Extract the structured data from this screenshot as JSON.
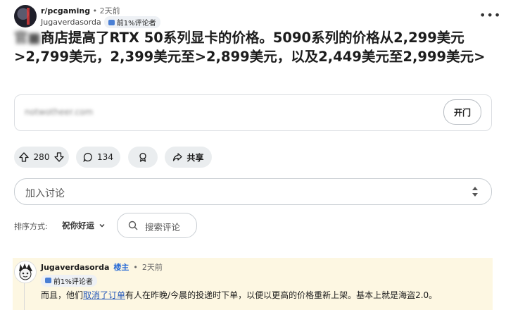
{
  "post": {
    "subreddit": "r/pcgaming",
    "separator": "•",
    "time": "2天前",
    "author": "Jugaverdasorda",
    "author_flair": "前1%评论者",
    "title_blurred": "官■",
    "title": "商店提高了RTX 50系列显卡的价格。5090系列的价格从2,299美元>2,799美元，2,399美元至>2,899美元，以及2,449美元至2,999美元>",
    "link_url": "notwotheer.com",
    "open_label": "开门"
  },
  "actions": {
    "upvotes": "280",
    "comments": "134",
    "share_label": "共享"
  },
  "add_comment": {
    "placeholder": "加入讨论"
  },
  "sort": {
    "label": "排序方式:",
    "value": "祝你好运"
  },
  "search": {
    "placeholder": "搜索评论"
  },
  "comment": {
    "author": "Jugaverdasorda",
    "op_badge": "楼主",
    "separator": "•",
    "time": "2天前",
    "flair": "前1%评论者",
    "body_before": "而且，他们",
    "body_link": "取消了订单",
    "body_after": "有人在昨晚/今晨的投递时下单，以便以更高的价格重新上架。基本上就是海盗2.0。"
  },
  "icons": {
    "more": "more-horizontal-icon",
    "upvote": "arrow-up-icon",
    "downvote": "arrow-down-icon",
    "comment": "speech-bubble-icon",
    "award": "award-icon",
    "share": "share-arrow-icon",
    "search": "search-icon",
    "sort": "chevron-down-icon"
  },
  "colors": {
    "pill_bg": "#eaedef",
    "comment_highlight": "#fdf7e2",
    "op_badge": "#2d6ed6",
    "link": "#2457b8"
  }
}
